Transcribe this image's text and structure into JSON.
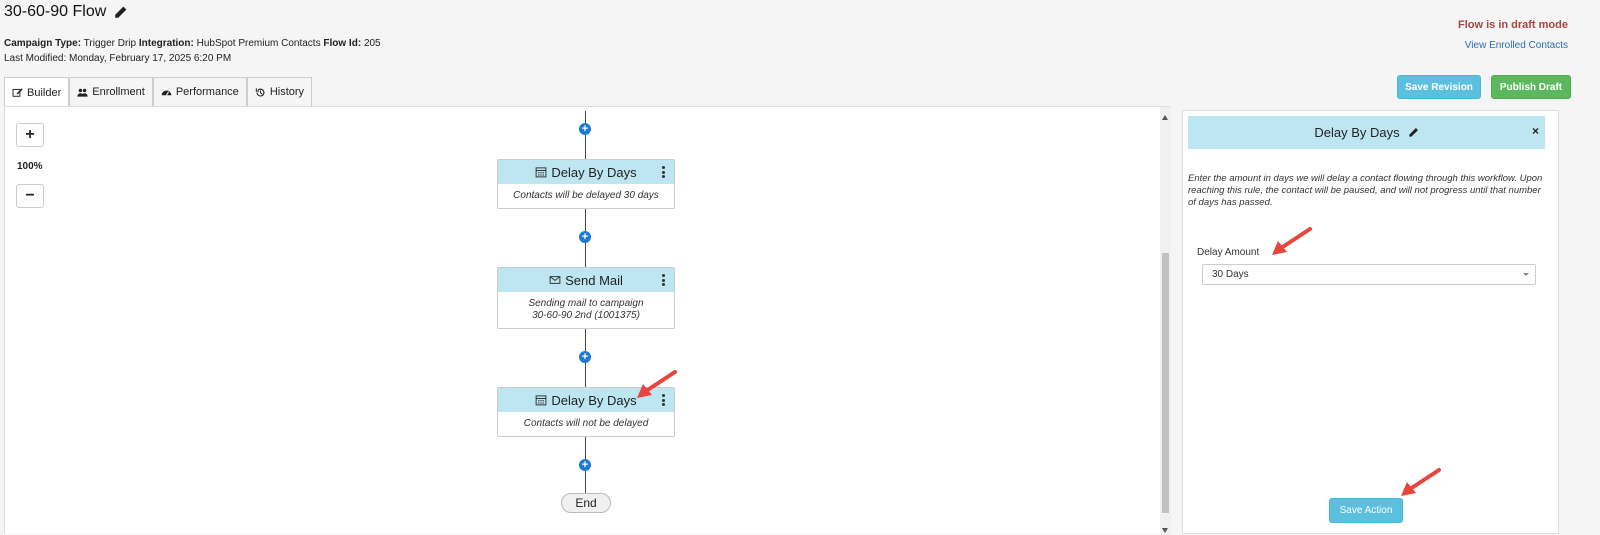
{
  "header": {
    "title": "30-60-90 Flow",
    "meta": {
      "campaign_type_label": "Campaign Type:",
      "campaign_type": "Trigger Drip",
      "integration_label": "Integration:",
      "integration": "HubSpot Premium Contacts",
      "flow_id_label": "Flow Id:",
      "flow_id": "205",
      "last_modified": "Last Modified: Monday, February 17, 2025 6:20 PM"
    },
    "status": "Flow is in draft mode",
    "enrolled_link": "View Enrolled Contacts"
  },
  "tabs": [
    {
      "label": "Builder",
      "icon": "edit-icon",
      "active": true
    },
    {
      "label": "Enrollment",
      "icon": "users-icon",
      "active": false
    },
    {
      "label": "Performance",
      "icon": "dashboard-icon",
      "active": false
    },
    {
      "label": "History",
      "icon": "history-icon",
      "active": false
    }
  ],
  "toolbar": {
    "save_revision": "Save Revision",
    "publish_draft": "Publish Draft"
  },
  "canvas": {
    "zoom_in": "+",
    "zoom_out": "−",
    "zoom_level": "100%",
    "nodes": [
      {
        "title": "Delay By Days",
        "icon": "calendar-icon",
        "body": "Contacts will be delayed 30 days"
      },
      {
        "title": "Send Mail",
        "icon": "envelope-icon",
        "body_line1": "Sending mail to campaign",
        "body_line2": "30-60-90 2nd (1001375)"
      },
      {
        "title": "Delay By Days",
        "icon": "calendar-icon",
        "body": "Contacts will not be delayed"
      }
    ],
    "end_label": "End"
  },
  "panel": {
    "title": "Delay By Days",
    "close": "×",
    "description": "Enter the amount in days we will delay a contact flowing through this workflow. Upon reaching this rule, the contact will be paused, and will not progress until that number of days has passed.",
    "delay_label": "Delay Amount",
    "delay_value": "30 Days",
    "save_action": "Save Action"
  },
  "colors": {
    "accent_blue": "#5bc0de",
    "header_blue": "#bde5f2",
    "publish_green": "#5cb85c",
    "draft_red": "#a94442",
    "plus_blue": "#1f7ad4",
    "annotation_arrow": "#e8453c"
  }
}
